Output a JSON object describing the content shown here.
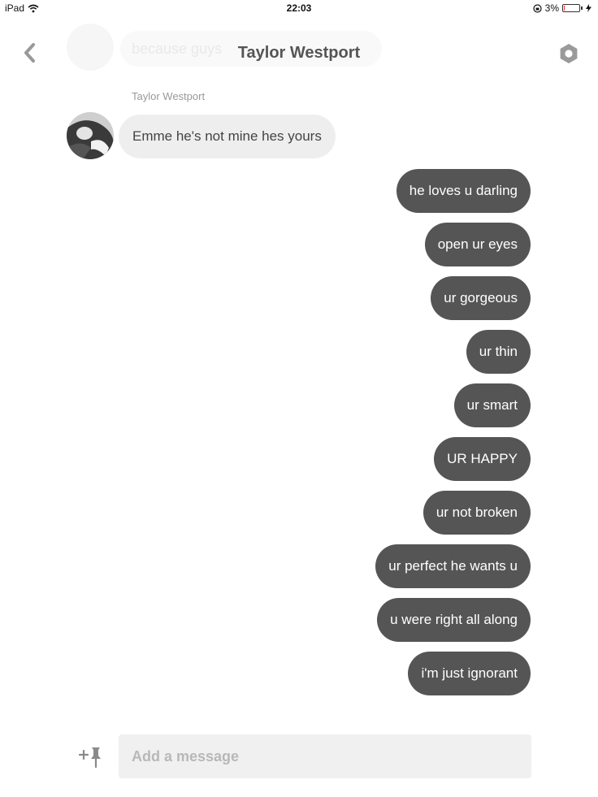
{
  "status_bar": {
    "device": "iPad",
    "time": "22:03",
    "battery": "3%",
    "battery_level": 0.03
  },
  "header": {
    "title": "Taylor Westport",
    "ghost_preview": "because guys"
  },
  "messages": {
    "received": {
      "sender": "Taylor Westport",
      "text": "Emme he's not mine hes yours"
    },
    "sent": [
      "he loves u darling",
      "open ur eyes",
      "ur gorgeous",
      "ur thin",
      "ur smart",
      "UR HAPPY",
      "ur not broken",
      "ur perfect he wants u",
      "u were right all along",
      "i'm just ignorant"
    ]
  },
  "composer": {
    "placeholder": "Add a message",
    "attach_icon": "add-pin-icon"
  },
  "colors": {
    "sent_bubble": "#555555",
    "received_bubble": "#eeeeee",
    "input_bg": "#f0f0f0"
  }
}
